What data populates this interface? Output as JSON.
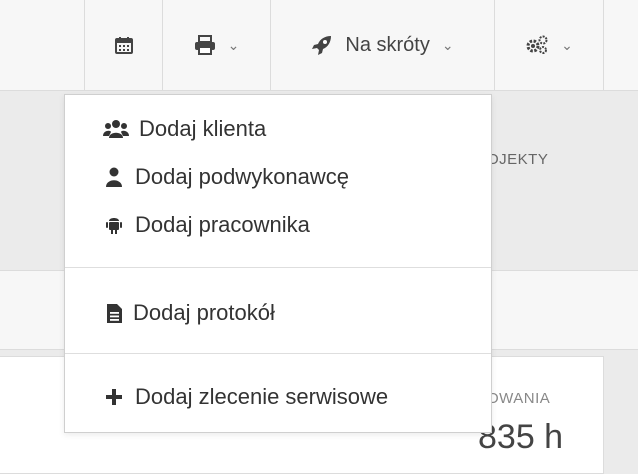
{
  "toolbar": {
    "calendar_icon": "calendar-icon",
    "print_icon": "printer-icon",
    "shortcuts_label": "Na skróty",
    "shortcuts_icon": "rocket-icon",
    "settings_icon": "cogs-icon",
    "chevron": "⌄"
  },
  "background": {
    "projects_label": "OJEKTY",
    "stat_label": "OWANIA",
    "stat_value": "835 h"
  },
  "dropdown": {
    "items": [
      {
        "label": "Dodaj klienta",
        "icon": "users-icon"
      },
      {
        "label": "Dodaj podwykonawcę",
        "icon": "user-icon"
      },
      {
        "label": "Dodaj pracownika",
        "icon": "android-icon"
      },
      {
        "label": "Dodaj protokół",
        "icon": "document-icon"
      },
      {
        "label": "Dodaj zlecenie serwisowe",
        "icon": "plus-icon"
      }
    ]
  },
  "colors": {
    "page_bg": "#ebebeb",
    "toolbar_bg": "#f7f7f7",
    "border": "#dcdcdc",
    "text": "#333333"
  }
}
